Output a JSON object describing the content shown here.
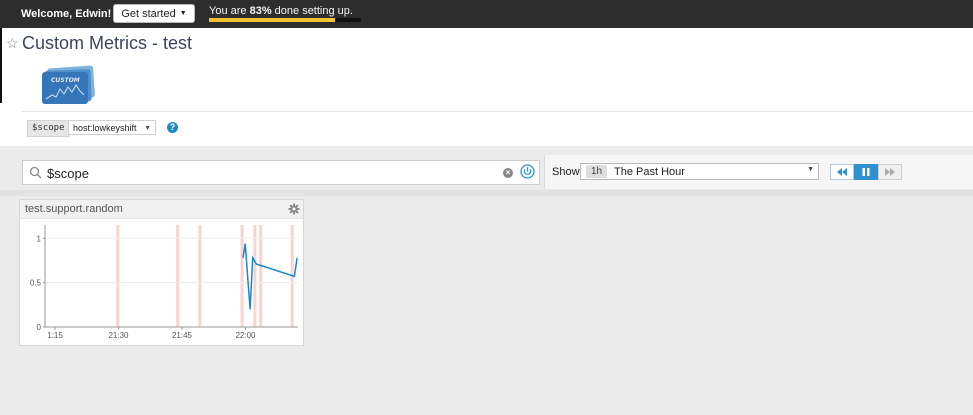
{
  "topbar": {
    "welcome": "Welcome, Edwin!",
    "get_started": "Get started",
    "progress_prefix": "You are ",
    "progress_percent": "83%",
    "progress_suffix": " done setting up.",
    "progress_value": 0.83,
    "progress_color": "#f2c230"
  },
  "header": {
    "title": "Custom Metrics - test",
    "logo_text": "CUSTOM"
  },
  "template_vars": {
    "scope_label": "$scope",
    "scope_value": "host:lowkeyshift"
  },
  "search": {
    "value": "$scope"
  },
  "timeframe": {
    "show_label": "Show",
    "short": "1h",
    "long": "The Past Hour"
  },
  "widget": {
    "title": "test.support.random"
  },
  "chart_data": {
    "type": "line",
    "title": "test.support.random",
    "xlabel": "",
    "ylabel": "",
    "x_ticks": [
      "1:15",
      "21:30",
      "21:45",
      "22:00"
    ],
    "y_ticks": [
      "1",
      "0.5",
      "0"
    ],
    "xlim": [
      0,
      57
    ],
    "ylim": [
      0,
      1.15
    ],
    "series": [
      {
        "color": "#1f87c5",
        "x": [
          44.6,
          45.1,
          46.2,
          46.8,
          47.6,
          56.2,
          56.8
        ],
        "y": [
          0.78,
          0.94,
          0.2,
          0.78,
          0.71,
          0.57,
          0.78
        ]
      }
    ],
    "event_markers_x": [
      16.4,
      29.9,
      34.9,
      44.4,
      47.3,
      48.6,
      55.7
    ],
    "event_color": "#f9d3d3",
    "grid": true
  }
}
